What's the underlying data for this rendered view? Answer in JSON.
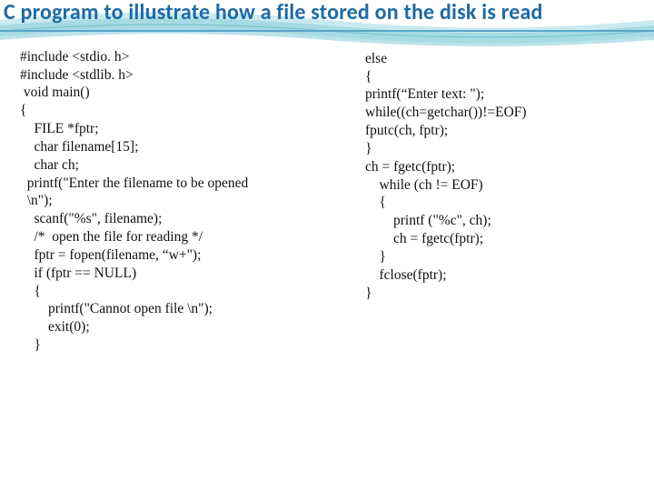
{
  "title": "C program to illustrate how a file stored on the disk is read",
  "code_left": "#include <stdio. h>\n#include <stdlib. h>\n void main()\n{\n    FILE *fptr;\n    char filename[15];\n    char ch;\n  printf(\"Enter the filename to be opened\n  \\n\");\n    scanf(\"%s\", filename);\n    /*  open the file for reading */\n    fptr = fopen(filename, “w+\");\n    if (fptr == NULL)\n    {\n        printf(\"Cannot open file \\n\");\n        exit(0);\n    }",
  "code_right": "else\n{\nprintf(“Enter text: \");\nwhile((ch=getchar())!=EOF)\nfputc(ch, fptr);\n}\nch = fgetc(fptr);\n    while (ch != EOF)\n    {\n        printf (\"%c\", ch);\n        ch = fgetc(fptr);\n    }\n    fclose(fptr);\n}"
}
